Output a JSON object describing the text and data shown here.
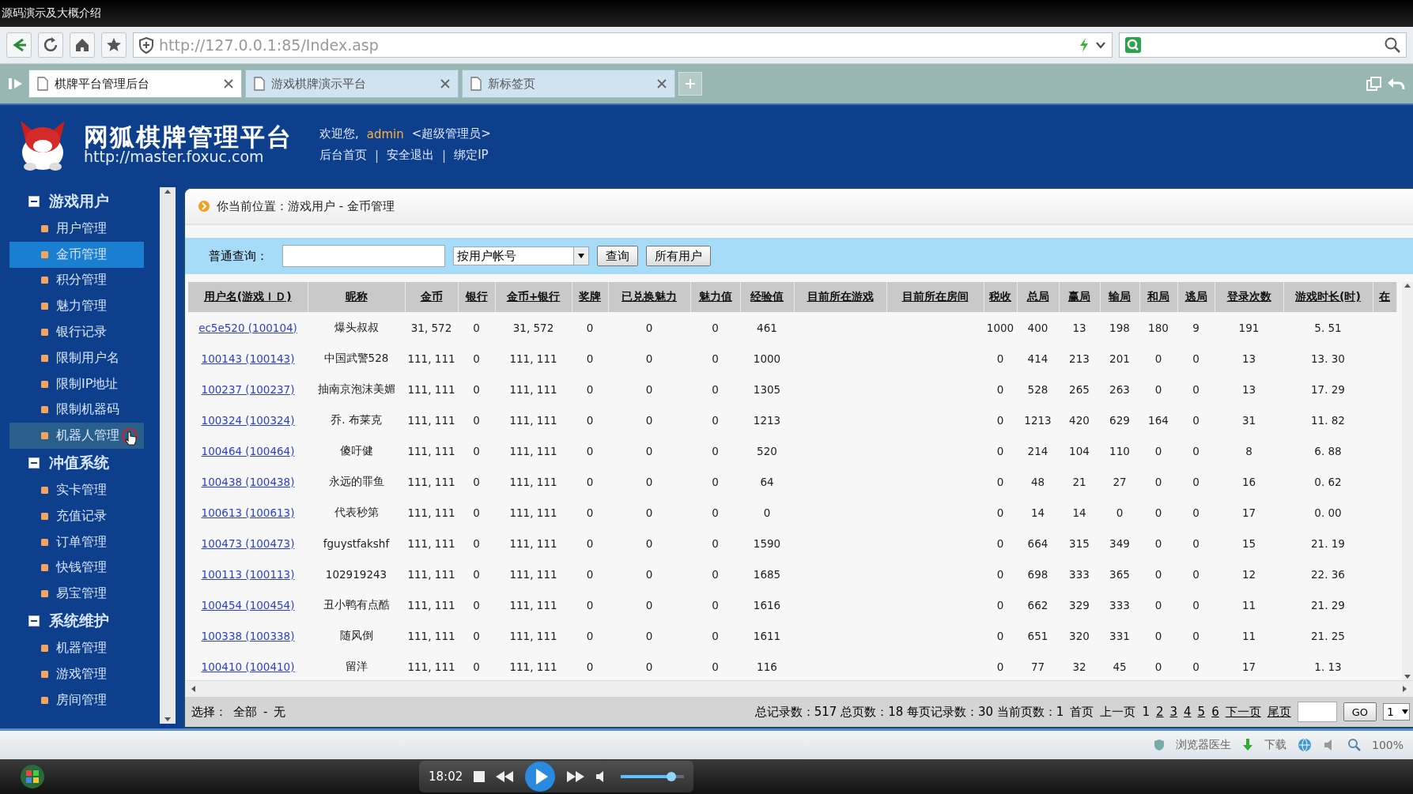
{
  "window": {
    "title": "源码演示及大概介绍"
  },
  "address_bar": {
    "url": "http://127.0.0.1:85/Index.asp"
  },
  "tabs": [
    {
      "label": "棋牌平台管理后台",
      "selected": true
    },
    {
      "label": "游戏棋牌演示平台",
      "selected": false
    },
    {
      "label": "新标签页",
      "selected": false
    }
  ],
  "header": {
    "title": "网狐棋牌管理平台",
    "site": "http://master.foxuc.com",
    "welcome": "欢迎您, ",
    "user": "admin",
    "role": "<超级管理员>",
    "links": [
      "后台首页",
      "安全退出",
      "绑定IP"
    ],
    "separator": "|"
  },
  "sidebar": {
    "groups": [
      {
        "label": "游戏用户",
        "expanded": true,
        "items": [
          {
            "label": "用户管理",
            "selected": false
          },
          {
            "label": "金币管理",
            "selected": true
          },
          {
            "label": "积分管理",
            "selected": false
          },
          {
            "label": "魅力管理",
            "selected": false
          },
          {
            "label": "银行记录",
            "selected": false
          },
          {
            "label": "限制用户名",
            "selected": false
          },
          {
            "label": "限制IP地址",
            "selected": false
          },
          {
            "label": "限制机器码",
            "selected": false
          },
          {
            "label": "机器人管理",
            "selected": false,
            "hovered": true
          }
        ]
      },
      {
        "label": "冲值系统",
        "expanded": true,
        "items": [
          {
            "label": "实卡管理",
            "selected": false
          },
          {
            "label": "充值记录",
            "selected": false
          },
          {
            "label": "订单管理",
            "selected": false
          },
          {
            "label": "快钱管理",
            "selected": false
          },
          {
            "label": "易宝管理",
            "selected": false
          }
        ]
      },
      {
        "label": "系统维护",
        "expanded": true,
        "items": [
          {
            "label": "机器管理",
            "selected": false
          },
          {
            "label": "游戏管理",
            "selected": false
          },
          {
            "label": "房间管理",
            "selected": false
          }
        ]
      }
    ]
  },
  "breadcrumb": "你当前位置：游戏用户 - 金币管理",
  "search": {
    "label": "普通查询：",
    "select": "按用户帐号",
    "buttons": [
      "查询",
      "所有用户"
    ]
  },
  "table": {
    "columns": [
      "用户名(游戏ＩＤ)",
      "昵称",
      "金币",
      "银行",
      "金币+银行",
      "奖牌",
      "已兑换魅力",
      "魅力值",
      "经验值",
      "目前所在游戏",
      "目前所在房间",
      "税收",
      "总局",
      "赢局",
      "输局",
      "和局",
      "逃局",
      "登录次数",
      "游戏时长(时)",
      "在"
    ],
    "rows": [
      [
        "ec5e520 (100104)",
        "爆头叔叔",
        "31, 572",
        "0",
        "31, 572",
        "0",
        "0",
        "0",
        "461",
        "",
        "",
        "1000",
        "400",
        "13",
        "198",
        "180",
        "9",
        "191",
        "5. 51",
        ""
      ],
      [
        "100143 (100143)",
        "中国武警528",
        "111, 111",
        "0",
        "111, 111",
        "0",
        "0",
        "0",
        "1000",
        "",
        "",
        "0",
        "414",
        "213",
        "201",
        "0",
        "0",
        "13",
        "13. 30",
        ""
      ],
      [
        "100237 (100237)",
        "抽南京泡沫美媚",
        "111, 111",
        "0",
        "111, 111",
        "0",
        "0",
        "0",
        "1305",
        "",
        "",
        "0",
        "528",
        "265",
        "263",
        "0",
        "0",
        "13",
        "17. 29",
        ""
      ],
      [
        "100324 (100324)",
        "乔. 布莱克",
        "111, 111",
        "0",
        "111, 111",
        "0",
        "0",
        "0",
        "1213",
        "",
        "",
        "0",
        "1213",
        "420",
        "629",
        "164",
        "0",
        "31",
        "11. 82",
        ""
      ],
      [
        "100464 (100464)",
        "傻吁健",
        "111, 111",
        "0",
        "111, 111",
        "0",
        "0",
        "0",
        "520",
        "",
        "",
        "0",
        "214",
        "104",
        "110",
        "0",
        "0",
        "8",
        "6. 88",
        ""
      ],
      [
        "100438 (100438)",
        "永远的罪鱼",
        "111, 111",
        "0",
        "111, 111",
        "0",
        "0",
        "0",
        "64",
        "",
        "",
        "0",
        "48",
        "21",
        "27",
        "0",
        "0",
        "16",
        "0. 62",
        ""
      ],
      [
        "100613 (100613)",
        "代表秒第",
        "111, 111",
        "0",
        "111, 111",
        "0",
        "0",
        "0",
        "0",
        "",
        "",
        "0",
        "14",
        "14",
        "0",
        "0",
        "0",
        "17",
        "0. 00",
        ""
      ],
      [
        "100473 (100473)",
        "fguystfakshf",
        "111, 111",
        "0",
        "111, 111",
        "0",
        "0",
        "0",
        "1590",
        "",
        "",
        "0",
        "664",
        "315",
        "349",
        "0",
        "0",
        "15",
        "21. 19",
        ""
      ],
      [
        "100113 (100113)",
        "102919243",
        "111, 111",
        "0",
        "111, 111",
        "0",
        "0",
        "0",
        "1685",
        "",
        "",
        "0",
        "698",
        "333",
        "365",
        "0",
        "0",
        "12",
        "22. 36",
        ""
      ],
      [
        "100454 (100454)",
        "丑小鸭有点酷",
        "111, 111",
        "0",
        "111, 111",
        "0",
        "0",
        "0",
        "1616",
        "",
        "",
        "0",
        "662",
        "329",
        "333",
        "0",
        "0",
        "11",
        "21. 29",
        ""
      ],
      [
        "100338 (100338)",
        "随风倒",
        "111, 111",
        "0",
        "111, 111",
        "0",
        "0",
        "0",
        "1611",
        "",
        "",
        "0",
        "651",
        "320",
        "331",
        "0",
        "0",
        "11",
        "21. 25",
        ""
      ],
      [
        "100410 (100410)",
        "留洋",
        "111, 111",
        "0",
        "111, 111",
        "0",
        "0",
        "0",
        "116",
        "",
        "",
        "0",
        "77",
        "32",
        "45",
        "0",
        "0",
        "17",
        "1. 13",
        ""
      ]
    ]
  },
  "footer": {
    "select_label": "选择：",
    "select_all": "全部",
    "separator": "-",
    "select_none": "无",
    "summary": "总记录数：517 总页数：18 每页记录数：30 当前页数：1",
    "first": "首页",
    "prev": "上一页",
    "pages": [
      {
        "label": "1",
        "selected": true
      },
      {
        "label": "2",
        "selected": false
      },
      {
        "label": "3",
        "selected": false
      },
      {
        "label": "4",
        "selected": false
      },
      {
        "label": "5",
        "selected": false
      },
      {
        "label": "6",
        "selected": false
      }
    ],
    "next": "下一页",
    "last": "尾页",
    "go": "GO",
    "page_select": "1"
  },
  "status_bar": {
    "doctor": "浏览器医生",
    "download": "下载",
    "zoom": "100%"
  },
  "player": {
    "time": "18:02",
    "volume": {
      "level": 0.8
    }
  }
}
